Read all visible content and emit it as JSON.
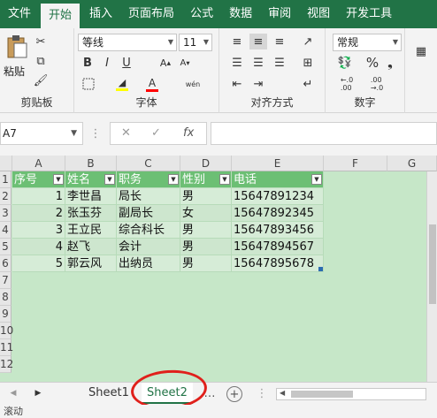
{
  "ribbon_tabs": [
    "文件",
    "开始",
    "插入",
    "页面布局",
    "公式",
    "数据",
    "审阅",
    "视图",
    "开发工具"
  ],
  "active_tab": "开始",
  "clipboard": {
    "paste_label": "粘贴",
    "group_label": "剪贴板"
  },
  "font": {
    "name": "等线",
    "size": "11",
    "group_label": "字体",
    "bold": "B",
    "italic": "I",
    "underline": "U",
    "phonetic": "wén",
    "highlight_color": "#ffff00",
    "font_color": "#ff0000"
  },
  "alignment": {
    "group_label": "对齐方式"
  },
  "number": {
    "format": "常规",
    "group_label": "数字",
    "percent": "%"
  },
  "formula_bar": {
    "name_box": "A7",
    "cancel": "✕",
    "enter": "✓",
    "fx": "fx",
    "formula": ""
  },
  "grid": {
    "columns": [
      "A",
      "B",
      "C",
      "D",
      "E",
      "F",
      "G"
    ],
    "rows": [
      "1",
      "2",
      "3",
      "4",
      "5",
      "6",
      "7",
      "8",
      "9",
      "10",
      "11",
      "12"
    ],
    "headers": [
      "序号",
      "姓名",
      "职务",
      "性别",
      "电话"
    ],
    "data": [
      [
        "1",
        "李世昌",
        "局长",
        "男",
        "15647891234"
      ],
      [
        "2",
        "张玉芬",
        "副局长",
        "女",
        "15647892345"
      ],
      [
        "3",
        "王立民",
        "综合科长",
        "男",
        "15647893456"
      ],
      [
        "4",
        "赵飞",
        "会计",
        "男",
        "15647894567"
      ],
      [
        "5",
        "郭云风",
        "出纳员",
        "男",
        "15647895678"
      ]
    ]
  },
  "sheets": [
    "Sheet1",
    "Sheet2"
  ],
  "active_sheet": "Sheet2",
  "status_text": "滚动",
  "colors": {
    "accent": "#217346",
    "grid_fill": "#c6e7c8",
    "header_fill": "#6cbf74",
    "annotation": "#e0201b"
  }
}
